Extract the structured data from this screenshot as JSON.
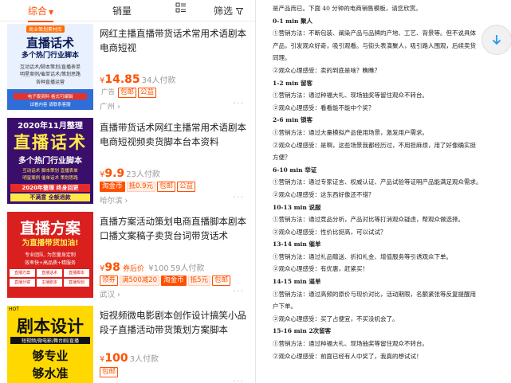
{
  "sort_bar": {
    "comprehensive": "综合",
    "sales": "销量",
    "filter": "筛选"
  },
  "products": [
    {
      "title": "网红主播直播带货话术常用术语剧本电商短视",
      "price_symbol": "¥",
      "price": "14.85",
      "paid": "34人付款",
      "tags": [
        {
          "text": "广告",
          "style": "gray"
        },
        {
          "text": "包邮",
          "style": "red"
        },
        {
          "text": "公益",
          "style": "red"
        }
      ],
      "location": "广州",
      "thumb": {
        "top_badge": "商业策划素材库",
        "line1": "直播话术",
        "line2": "多个热门行业脚本",
        "line3": "互动话术/脚本策划/直播表单",
        "line4": "明星案例/催单话术/策划思路",
        "line5": "各种直播运营",
        "footer1": "电子版资料 格式可编辑",
        "footer2": "试看内容 请联系客服"
      }
    },
    {
      "title": "直播带货话术网红主播常用术语剧本电商短视频卖货脚本台本资料",
      "price_symbol": "¥",
      "price": "9.9",
      "paid": "23人付款",
      "tags": [
        {
          "text": "淘金币",
          "style": "fill"
        },
        {
          "text": "抵0.9元",
          "style": "ofill"
        },
        {
          "text": "包邮",
          "style": "red"
        },
        {
          "text": "公益",
          "style": "red"
        }
      ],
      "location": "哈尔滨",
      "thumb": {
        "top": "2020年11月整理",
        "line1": "直播话术",
        "line2": "多个热门行业脚本",
        "line3": "互动话术 脚本策划 直播表单",
        "line4": "明星案例 催单话术 策划思路",
        "line5": "2020年整理 终身回更",
        "line6": "不满意 全额退款"
      }
    },
    {
      "title": "直播方案活动策划电商直播脚本剧本口播文案稿子卖货台词带货话术",
      "price_symbol": "¥",
      "price": "98",
      "after": "券后价",
      "orig": "¥100",
      "paid": "59人付款",
      "tags": [
        {
          "text": "领券",
          "style": "red"
        },
        {
          "text": "满500减20",
          "style": "ofill"
        },
        {
          "text": "淘金币",
          "style": "fill"
        },
        {
          "text": "抵5元",
          "style": "ofill"
        },
        {
          "text": "包邮",
          "style": "red"
        }
      ],
      "location": "武汉",
      "thumb": {
        "line1": "直播方案",
        "line2": "为直播带货加油!",
        "line3": "专业团队, 为您量身定制",
        "line4": "效率快+高品质+精服务",
        "line5": "直播方案 直播话术 直播脚本 ...",
        "btns": [
          "直播方案",
          "直播话术",
          "直播脚本",
          "直播分镜",
          "主播剧本",
          "直播规划"
        ]
      }
    },
    {
      "title": "短视频微电影剧本创作设计搞笑小品段子直播活动带货策划方案脚本",
      "price_symbol": "¥",
      "price": "100",
      "paid": "3人付款",
      "tags": [
        {
          "text": "包邮",
          "style": "red"
        }
      ],
      "location": "",
      "thumb": {
        "top": "HOT",
        "line1": "剧本设计",
        "line2": "短视频/微电影/舞台剧/直播",
        "line3": "够专业",
        "line4": "够水准"
      }
    }
  ],
  "document": {
    "intro": "是产品而已。下面 40 分钟的电商销售模板，请您欣赏。",
    "sections": [
      {
        "head": "0-1 min  聚人",
        "l1": "①营销方法：不断包装、阐染产品与品牌的产地、工艺、背景等。但不说具体",
        "l1b": "产品，引发观众好奇，吸引观看。与街头表演聚人，吸引路人围观，后续卖货",
        "l1c": "同理。",
        "l2": "②观众心理感受：卖的到底是啥？瞧瞧？"
      },
      {
        "head": "1-2 min  留客",
        "l1": "①营销方法：通过种福大礼、现场抽奖等留住观众不转台。",
        "l2": "②观众心理感受：看看能不能中个奖？"
      },
      {
        "head": "2-6 min  锁客",
        "l1": "①营销方法：通过大量模拟产品使用场景，激发用户需求。",
        "l2": "②观众心理感受：是啊，这些场景我都经历过，不用担麻烦，用了好像确实挺",
        "l2b": "方便？"
      },
      {
        "head": "6-10 min  举证",
        "l1": "①营销方法：通过专家证言、权威认证、产品试验等证明产品能满足观众需求。",
        "l2": "②观众心理感受：这东西好像还不错？"
      },
      {
        "head": "10-13 min  说服",
        "l1": "①营销方法：通过竞品分析，产品对比等打消观众疑虑，帮观众做选择。",
        "l2": "②观众心理感受：性价比挺高，可以试试？"
      },
      {
        "head": "13-14 min  催单",
        "l1": "①营销方法：通过礼品赠送、折扣礼金、增值服务等引诱观众下单。",
        "l2": "②观众心理感受：有优惠，赶紧买！"
      },
      {
        "head": "14-15 min  逼单",
        "l1": "①营销方法：通过高频的原价与现价对比，活动期限，名额紧张等反复提醒用",
        "l1b": "户下单。",
        "l2": "②观众心理感受：买了占便宜，不买没机会了。"
      },
      {
        "head": "15-16 min  2次留客",
        "l1": "①营销方法：通过种福大礼、现场抽奖等留住观众不转台。",
        "l2": "②观众心理感受：前面已经有人中奖了，我真的想试试！"
      }
    ]
  },
  "colors": {
    "accent": "#ff5000",
    "scroll_arrow": "#2196f3"
  },
  "icons": {
    "list_view": "list-view-icon",
    "filter": "funnel-icon",
    "scroll_down": "arrow-down-icon"
  }
}
